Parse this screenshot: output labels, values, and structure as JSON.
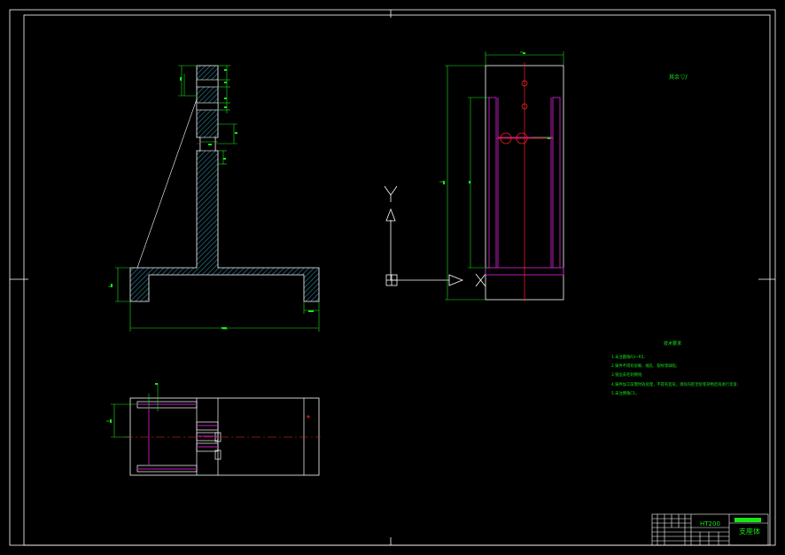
{
  "drawing": {
    "background": "#000000",
    "colors": {
      "outline": "#ffffff",
      "dimension": "#19e619",
      "hatch": "#2e8fa6",
      "centerline": "#ff2020",
      "hidden": "#c81ec8"
    }
  },
  "ucs": {
    "y_label": "Y",
    "x_label": "X"
  },
  "surface_roughness": {
    "label": "其余",
    "symbol": "▽/"
  },
  "technical_requirements": {
    "title": "技术要求",
    "items": [
      "1.未注圆角R3~R5;",
      "2.铸件不得有砂眼、缩孔、裂纹等缺陷;",
      "3.锐边去毛刺倒钝;",
      "4.铸件加工前需时效处理，不得有变形，清除内腔型砂等杂物后再进行涂漆;",
      "5.未注倒角C1。"
    ]
  },
  "title_block": {
    "material": "HT200",
    "part_name": "支座体"
  },
  "dimensions": {
    "base_width": "320",
    "base_height": "40",
    "right_view_width": "85",
    "right_view_height": "280",
    "top_view_depth": "80"
  }
}
